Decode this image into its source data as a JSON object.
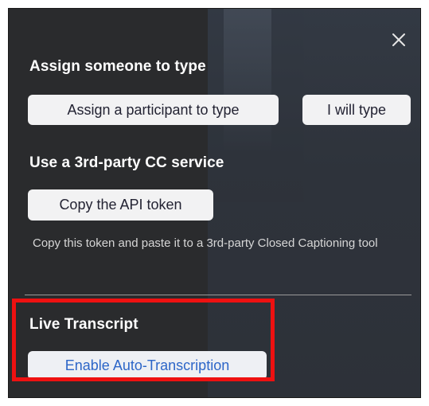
{
  "dialog": {
    "close_icon": "close-icon",
    "assign_section": {
      "title": "Assign someone to type",
      "assign_button_label": "Assign a participant to type",
      "self_button_label": "I will type"
    },
    "cc_service_section": {
      "title": "Use a 3rd-party CC service",
      "copy_button_label": "Copy the API token",
      "description": "Copy this token and paste it to a 3rd-party Closed Captioning tool"
    },
    "live_transcript_section": {
      "title": "Live Transcript",
      "enable_button_label": "Enable Auto-Transcription"
    }
  },
  "colors": {
    "panel_background": "#2a2b2d",
    "highlight_border": "#ee1111",
    "link_blue": "#2d66c8"
  }
}
